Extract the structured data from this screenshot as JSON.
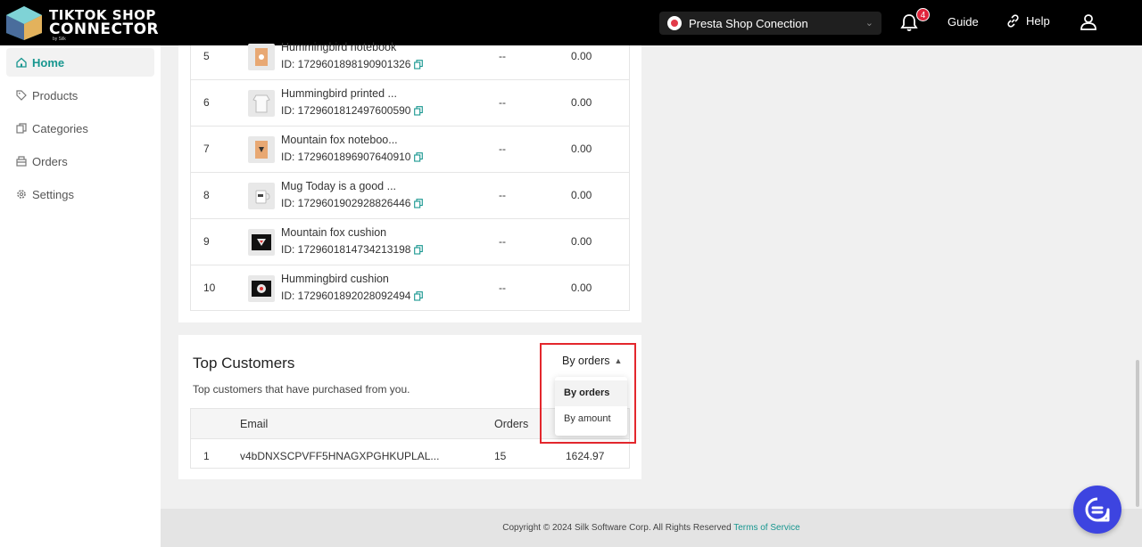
{
  "header": {
    "logo_line1": "TIKTOK SHOP",
    "logo_line2": "CONNECTOR",
    "logo_sub": "by Silk",
    "shop_select": "Presta Shop Conection",
    "notification_count": "4",
    "guide_label": "Guide",
    "help_label": "Help"
  },
  "sidebar": {
    "items": [
      {
        "label": "Home",
        "icon": "home-icon",
        "active": true
      },
      {
        "label": "Products",
        "icon": "tag-icon",
        "active": false
      },
      {
        "label": "Categories",
        "icon": "copy-icon",
        "active": false
      },
      {
        "label": "Orders",
        "icon": "box-icon",
        "active": false
      },
      {
        "label": "Settings",
        "icon": "gear-icon",
        "active": false
      }
    ]
  },
  "top_products": {
    "rows": [
      {
        "rank": "5",
        "name": "Hummingbird notebook",
        "id": "ID: 1729601898190901326",
        "qty": "--",
        "amount": "0.00"
      },
      {
        "rank": "6",
        "name": "Hummingbird printed ...",
        "id": "ID: 1729601812497600590",
        "qty": "--",
        "amount": "0.00"
      },
      {
        "rank": "7",
        "name": "Mountain fox noteboo...",
        "id": "ID: 1729601896907640910",
        "qty": "--",
        "amount": "0.00"
      },
      {
        "rank": "8",
        "name": "Mug Today is a good ...",
        "id": "ID: 1729601902928826446",
        "qty": "--",
        "amount": "0.00"
      },
      {
        "rank": "9",
        "name": "Mountain fox cushion",
        "id": "ID: 1729601814734213198",
        "qty": "--",
        "amount": "0.00"
      },
      {
        "rank": "10",
        "name": "Hummingbird cushion",
        "id": "ID: 1729601892028092494",
        "qty": "--",
        "amount": "0.00"
      }
    ]
  },
  "top_customers": {
    "title": "Top Customers",
    "subtitle": "Top customers that have purchased from you.",
    "sort_label": "By orders",
    "sort_options": [
      "By orders",
      "By amount"
    ],
    "columns": {
      "email": "Email",
      "orders": "Orders"
    },
    "rows": [
      {
        "rank": "1",
        "email": "v4bDNXSCPVFF5HNAGXPGHKUPLAL...",
        "orders": "15",
        "amount": "1624.97"
      }
    ]
  },
  "footer": {
    "copyright": "Copyright © 2024 Silk Software Corp. All Rights Reserved",
    "tos": "Terms of Service"
  },
  "colors": {
    "accent": "#17968f",
    "highlight": "#e3272d",
    "badge": "#e0243b",
    "chat": "#3d44e0"
  }
}
